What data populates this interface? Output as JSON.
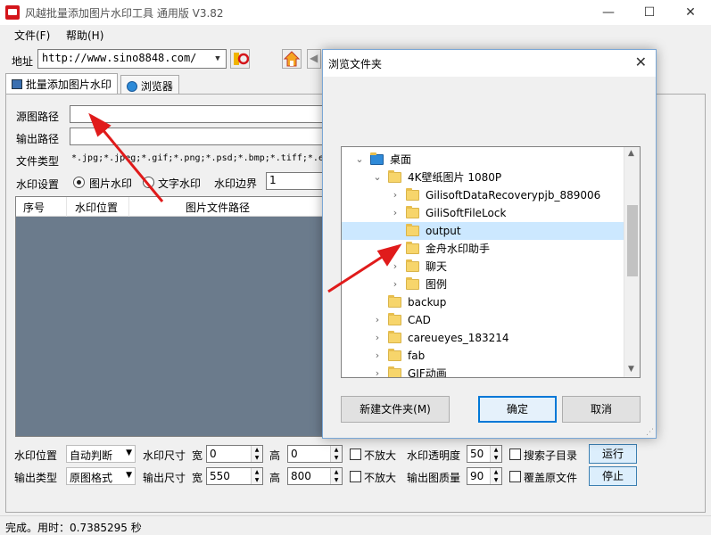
{
  "window": {
    "title": "风越批量添加图片水印工具 通用版 V3.82",
    "minimize": "—",
    "maximize": "☐",
    "close": "✕"
  },
  "menu": [
    {
      "label": "文件(F)"
    },
    {
      "label": "帮助(H)"
    }
  ],
  "address": {
    "label": "地址",
    "value": "http://www.sino8848.com/"
  },
  "tabs": [
    {
      "label": "批量添加图片水印"
    },
    {
      "label": "浏览器"
    }
  ],
  "form": {
    "source_path_label": "源图路径",
    "output_path_label": "输出路径",
    "file_type_label": "文件类型",
    "file_type_value": "*.jpg;*.jpeg;*.gif;*.png;*.psd;*.bmp;*.tiff;*.e",
    "watermark_settings_label": "水印设置",
    "radio_image": "图片水印",
    "radio_text": "文字水印",
    "margin_label": "水印边界",
    "margin_value": "1"
  },
  "list": {
    "columns": [
      "序号",
      "水印位置",
      "图片文件路径"
    ]
  },
  "bottom": {
    "row1": {
      "position_label": "水印位置",
      "position_value": "自动判断",
      "wm_size_label": "水印尺寸",
      "width_label": "宽",
      "width_value": "0",
      "height_label": "高",
      "height_value": "0",
      "no_enlarge": "不放大",
      "opacity_label": "水印透明度",
      "opacity_value": "50",
      "search_sub": "搜索子目录",
      "run_button": "运行"
    },
    "row2": {
      "type_label": "输出类型",
      "type_value": "原图格式",
      "out_size_label": "输出尺寸",
      "width_label": "宽",
      "width_value": "550",
      "height_label": "高",
      "height_value": "800",
      "no_enlarge": "不放大",
      "quality_label": "输出图质量",
      "quality_value": "90",
      "overwrite": "覆盖原文件",
      "stop_button": "停止"
    }
  },
  "status": {
    "text": "完成。用时：0.7385295 秒"
  },
  "dialog": {
    "title": "浏览文件夹",
    "close": "✕",
    "tree": [
      {
        "label": "桌面",
        "depth": 0,
        "expanded": true
      },
      {
        "label": "4K壁纸图片 1080P",
        "depth": 1,
        "expanded": true
      },
      {
        "label": "GilisoftDataRecoverypjb_889006",
        "depth": 2,
        "expanded": false
      },
      {
        "label": "GiliSoftFileLock",
        "depth": 2,
        "expanded": false
      },
      {
        "label": "output",
        "depth": 2,
        "selected": true
      },
      {
        "label": "金舟水印助手",
        "depth": 2,
        "expanded": false
      },
      {
        "label": "聊天",
        "depth": 2,
        "expanded": false
      },
      {
        "label": "图例",
        "depth": 2,
        "expanded": false
      },
      {
        "label": "backup",
        "depth": 1
      },
      {
        "label": "CAD",
        "depth": 1,
        "expanded": false
      },
      {
        "label": "careueyes_183214",
        "depth": 1,
        "expanded": false
      },
      {
        "label": "fab",
        "depth": 1,
        "expanded": false
      },
      {
        "label": "GIF动画",
        "depth": 1,
        "expanded": false
      }
    ],
    "new_folder_button": "新建文件夹(M)",
    "ok_button": "确定",
    "cancel_button": "取消"
  },
  "colors": {
    "list_bg": "#6b7b8c",
    "annotation_arrow": "#e01b1b",
    "selection": "#cce8ff",
    "accent": "#0078d7"
  }
}
